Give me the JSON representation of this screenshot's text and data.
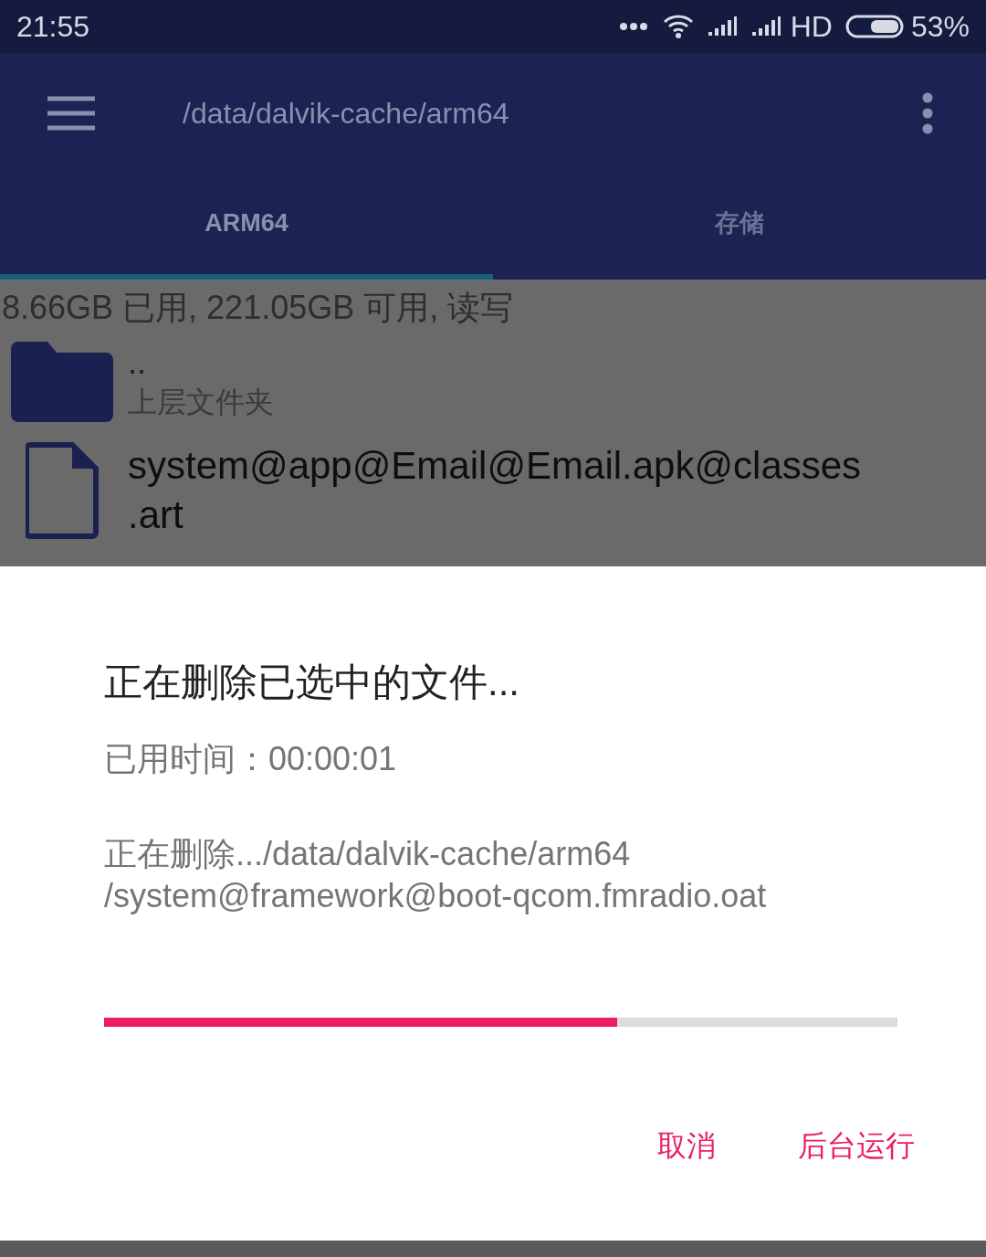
{
  "status_bar": {
    "time": "21:55",
    "battery": "53%",
    "network": "HD"
  },
  "toolbar": {
    "path": "/data/dalvik-cache/arm64"
  },
  "tabs": [
    {
      "label": "ARM64",
      "selected": true
    },
    {
      "label": "存储",
      "selected": false
    }
  ],
  "storage_info": "8.66GB 已用, 221.05GB 可用, 读写",
  "files": [
    {
      "kind": "folder",
      "name_lines": [
        ".."
      ],
      "subtitle": "上层文件夹"
    },
    {
      "kind": "file",
      "name_lines": [
        "system@app@Email@Email.apk@classes",
        ".art"
      ]
    }
  ],
  "dialog": {
    "title": "正在删除已选中的文件...",
    "elapsed": "已用时间：00:00:01",
    "message_lines": [
      "正在删除.../data/dalvik-cache/arm64",
      "/system@framework@boot-qcom.fmradio.oat"
    ],
    "progress": {
      "level": 0.647
    },
    "buttons": [
      "取消",
      "后台运行"
    ]
  }
}
